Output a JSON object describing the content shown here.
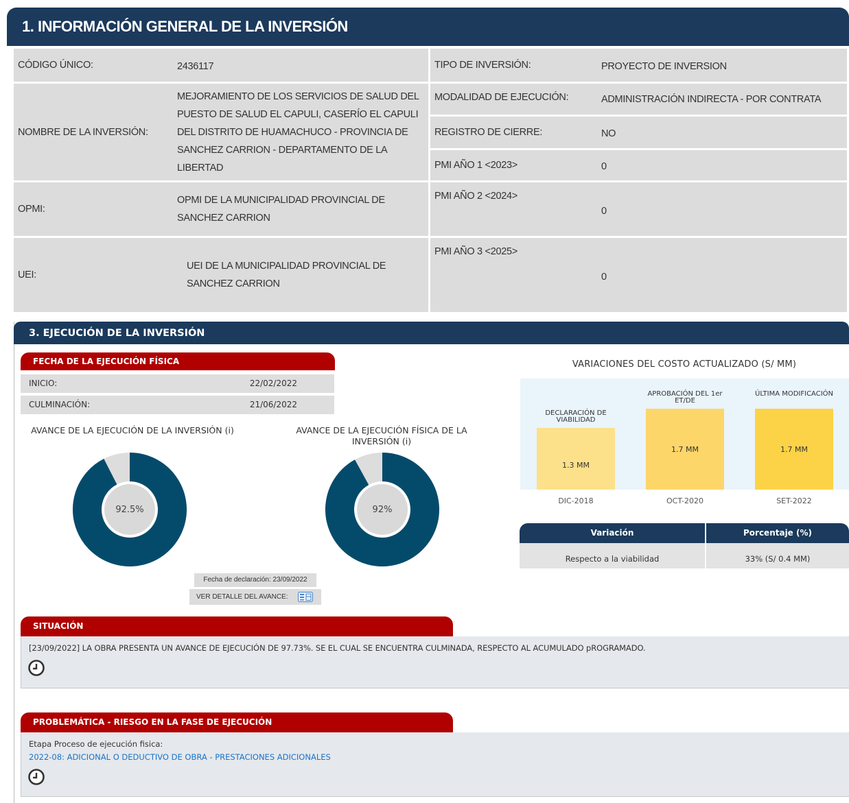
{
  "section1": {
    "title": "1. INFORMACIÓN GENERAL DE LA INVERSIÓN",
    "codigo_label": "CÓDIGO ÚNICO:",
    "codigo_value": "2436117",
    "tipo_label": "TIPO DE INVERSIÓN:",
    "tipo_value": "PROYECTO DE INVERSION",
    "nombre_label": "NOMBRE DE LA INVERSIÓN:",
    "nombre_value": "MEJORAMIENTO DE LOS SERVICIOS DE SALUD DEL PUESTO DE SALUD EL CAPULI, CASERÍO EL CAPULI DEL DISTRITO DE HUAMACHUCO - PROVINCIA DE SANCHEZ CARRION - DEPARTAMENTO DE LA LIBERTAD",
    "modalidad_label": "MODALIDAD DE EJECUCIÓN:",
    "modalidad_value": "ADMINISTRACIÓN INDIRECTA - POR CONTRATA",
    "registro_label": "REGISTRO DE CIERRE:",
    "registro_value": "NO",
    "pmi1_label": "PMI AÑO 1 <2023>",
    "pmi1_value": "0",
    "opmi_label": "OPMI:",
    "opmi_value": "OPMI DE LA MUNICIPALIDAD PROVINCIAL DE SANCHEZ CARRION",
    "pmi2_label": "PMI AÑO 2 <2024>",
    "pmi2_value": "0",
    "uei_label": "UEI:",
    "uei_value": "UEI DE LA MUNICIPALIDAD PROVINCIAL DE SANCHEZ CARRION",
    "pmi3_label": "PMI AÑO 3 <2025>",
    "pmi3_value": "0"
  },
  "section3": {
    "title": "3. EJECUCIÓN DE LA INVERSIÓN",
    "fecha_tab": "FECHA DE LA EJECUCIÓN FÍSICA",
    "inicio_label": "INICIO:",
    "inicio_value": "22/02/2022",
    "culminacion_label": "CULMINACIÓN:",
    "culminacion_value": "21/06/2022",
    "donut1_title": "AVANCE DE LA EJECUCIÓN DE LA INVERSIÓN (i)",
    "donut1_value": "92.5%",
    "donut1_fraction": 0.925,
    "donut2_title": "AVANCE DE LA EJECUCIÓN FÍSICA DE LA INVERSIÓN (i)",
    "donut2_value": "92%",
    "donut2_fraction": 0.92,
    "fecha_declaracion": "Fecha de declaración: 23/09/2022",
    "ver_detalle": "VER DETALLE DEL AVANCE:",
    "chart_title": "VARIACIONES DEL COSTO ACTUALIZADO (S/ MM)",
    "variacion_header": "Variación",
    "porcentaje_header": "Porcentaje (%)",
    "variacion_value": "Respecto a la viabilidad",
    "porcentaje_value": "33% (S/ 0.4 MM)",
    "situacion_tab": "SITUACIÓN",
    "situacion_text": "[23/09/2022] LA OBRA PRESENTA UN AVANCE DE EJECUCIÓN DE 97.73%. SE EL CUAL SE ENCUENTRA CULMINADA, RESPECTO AL ACUMULADO pROGRAMADO.",
    "problematica_tab": "PROBLEMÁTICA - RIESGO EN LA FASE DE EJECUCIÓN",
    "problematica_label": "Etapa Proceso de ejecución fisica:",
    "problematica_link": "2022-08: ADICIONAL O DEDUCTIVO DE OBRA - PRESTACIONES ADICIONALES"
  },
  "colors": {
    "header_navy": "#1b3a5c",
    "tab_red": "#b00000",
    "donut_fill": "#044b6b",
    "bar_light": "#fde08a",
    "bar_mid": "#fdd66a",
    "bar_dark": "#fcd346",
    "link_blue": "#1a73c9"
  },
  "chart_data": {
    "type": "bar",
    "title": "VARIACIONES DEL COSTO ACTUALIZADO (S/ MM)",
    "categories": [
      "DIC-2018",
      "OCT-2020",
      "SET-2022"
    ],
    "bar_titles": [
      "DECLARACIÓN DE VIABILIDAD",
      "APROBACIÓN DEL 1er ET/DE",
      "ÚLTIMA MODIFICACIÓN"
    ],
    "values": [
      1.3,
      1.7,
      1.7
    ],
    "value_labels": [
      "1.3 MM",
      "1.7 MM",
      "1.7 MM"
    ]
  }
}
